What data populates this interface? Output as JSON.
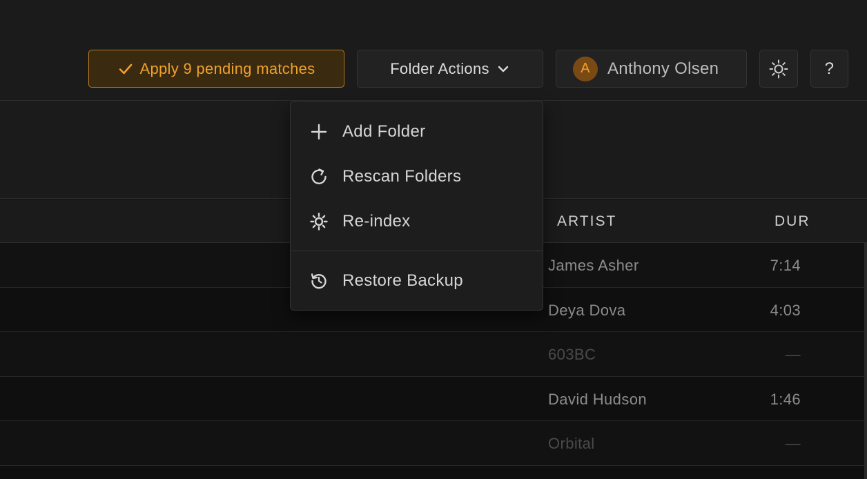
{
  "toolbar": {
    "apply_label": "Apply 9 pending matches",
    "folder_actions_label": "Folder Actions",
    "user": {
      "initial": "A",
      "name": "Anthony Olsen"
    },
    "help_label": "?"
  },
  "colors": {
    "accent": "#f0a12c",
    "accent_bg": "#3a2a10",
    "background": "#0f0f0f",
    "surface": "#1b1b1b"
  },
  "table": {
    "columns": {
      "artist": "ARTIST",
      "dur": "DUR"
    },
    "rows": [
      {
        "artist": "James Asher",
        "dur": "7:14",
        "state": "normal"
      },
      {
        "artist": "Deya Dova",
        "dur": "4:03",
        "state": "normal"
      },
      {
        "artist": "603BC",
        "dur": "—",
        "state": "dim"
      },
      {
        "artist": "David Hudson",
        "dur": "1:46",
        "state": "normal"
      },
      {
        "artist": "Orbital",
        "dur": "—",
        "state": "dim"
      }
    ]
  },
  "folder_menu": {
    "items": [
      {
        "label": "Add Folder",
        "icon": "plus-icon"
      },
      {
        "label": "Rescan Folders",
        "icon": "refresh-icon"
      },
      {
        "label": "Re-index",
        "icon": "gear-icon"
      },
      {
        "label": "Restore Backup",
        "icon": "restore-icon"
      }
    ]
  },
  "icons": {
    "apply": "checkmark-icon",
    "folder_actions": "chevron-down-icon",
    "theme": "sun-icon"
  }
}
